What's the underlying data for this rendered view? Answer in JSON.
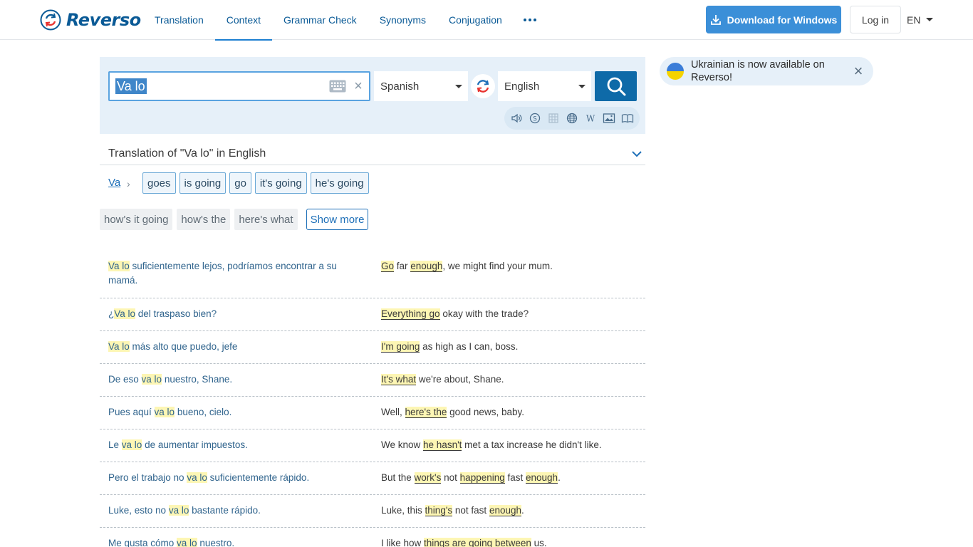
{
  "header": {
    "logo_text": "Reverso",
    "nav": [
      {
        "label": "Translation",
        "active": false
      },
      {
        "label": "Context",
        "active": true
      },
      {
        "label": "Grammar Check",
        "active": false
      },
      {
        "label": "Synonyms",
        "active": false
      },
      {
        "label": "Conjugation",
        "active": false
      }
    ],
    "download_label": "Download for Windows",
    "login_label": "Log in",
    "lang_label": "EN"
  },
  "search": {
    "query": "Va lo",
    "source_lang": "Spanish",
    "target_lang": "English"
  },
  "banner": {
    "text": "Ukrainian is now available on Reverso!"
  },
  "translation_header": "Translation of \"Va lo\" in English",
  "breadcrumb": "Va",
  "primary_translations": [
    "goes",
    "is going",
    "go",
    "it's going",
    "he's going"
  ],
  "secondary_translations": [
    "how's it going",
    "how's the",
    "here's what"
  ],
  "show_more_label": "Show more",
  "examples": [
    {
      "src": [
        {
          "t": "Va lo",
          "h": true
        },
        {
          "t": " suficientemente lejos, podríamos encontrar a su mamá.",
          "h": false
        }
      ],
      "tgt": [
        {
          "t": "Go",
          "h": true
        },
        {
          "t": " far ",
          "h": false
        },
        {
          "t": "enough",
          "h": true
        },
        {
          "t": ", we might find your mum.",
          "h": false
        }
      ]
    },
    {
      "src": [
        {
          "t": "¿",
          "h": false
        },
        {
          "t": "Va lo",
          "h": true
        },
        {
          "t": " del traspaso bien?",
          "h": false
        }
      ],
      "tgt": [
        {
          "t": "Everything go",
          "h": true
        },
        {
          "t": " okay with the trade?",
          "h": false
        }
      ]
    },
    {
      "src": [
        {
          "t": "Va lo",
          "h": true
        },
        {
          "t": " más alto que puedo, jefe",
          "h": false
        }
      ],
      "tgt": [
        {
          "t": "I'm going",
          "h": true
        },
        {
          "t": " as high as I can, boss.",
          "h": false
        }
      ]
    },
    {
      "src": [
        {
          "t": "De eso ",
          "h": false
        },
        {
          "t": "va lo",
          "h": true
        },
        {
          "t": " nuestro, Shane.",
          "h": false
        }
      ],
      "tgt": [
        {
          "t": "It's what",
          "h": true
        },
        {
          "t": " we're about, Shane.",
          "h": false
        }
      ]
    },
    {
      "src": [
        {
          "t": "Pues aquí ",
          "h": false
        },
        {
          "t": "va lo",
          "h": true
        },
        {
          "t": " bueno, cielo.",
          "h": false
        }
      ],
      "tgt": [
        {
          "t": "Well, ",
          "h": false
        },
        {
          "t": "here's the",
          "h": true
        },
        {
          "t": " good news, baby.",
          "h": false
        }
      ]
    },
    {
      "src": [
        {
          "t": "Le ",
          "h": false
        },
        {
          "t": "va lo",
          "h": true
        },
        {
          "t": " de aumentar impuestos.",
          "h": false
        }
      ],
      "tgt": [
        {
          "t": "We know ",
          "h": false
        },
        {
          "t": "he hasn't",
          "h": true
        },
        {
          "t": " met a tax increase he didn't like.",
          "h": false
        }
      ]
    },
    {
      "src": [
        {
          "t": "Pero el trabajo no ",
          "h": false
        },
        {
          "t": "va lo",
          "h": true
        },
        {
          "t": " suficientemente rápido.",
          "h": false
        }
      ],
      "tgt": [
        {
          "t": "But the ",
          "h": false
        },
        {
          "t": "work's",
          "h": true
        },
        {
          "t": " not ",
          "h": false
        },
        {
          "t": "happening",
          "h": true
        },
        {
          "t": " fast ",
          "h": false
        },
        {
          "t": "enough",
          "h": true
        },
        {
          "t": ".",
          "h": false
        }
      ]
    },
    {
      "src": [
        {
          "t": "Luke, esto no ",
          "h": false
        },
        {
          "t": "va lo",
          "h": true
        },
        {
          "t": " bastante rápido.",
          "h": false
        }
      ],
      "tgt": [
        {
          "t": "Luke, this ",
          "h": false
        },
        {
          "t": "thing's",
          "h": true
        },
        {
          "t": " not fast ",
          "h": false
        },
        {
          "t": "enough",
          "h": true
        },
        {
          "t": ".",
          "h": false
        }
      ]
    },
    {
      "src": [
        {
          "t": "Me gusta cómo ",
          "h": false
        },
        {
          "t": "va lo",
          "h": true
        },
        {
          "t": " nuestro.",
          "h": false
        }
      ],
      "tgt": [
        {
          "t": "I like how ",
          "h": false
        },
        {
          "t": "things are going between",
          "h": true
        },
        {
          "t": " us.",
          "h": false
        }
      ]
    }
  ],
  "colors": {
    "brand": "#0a5a96",
    "accent": "#3b8fd8",
    "highlight": "#fdf6b4",
    "panel": "#e6f0f9"
  }
}
